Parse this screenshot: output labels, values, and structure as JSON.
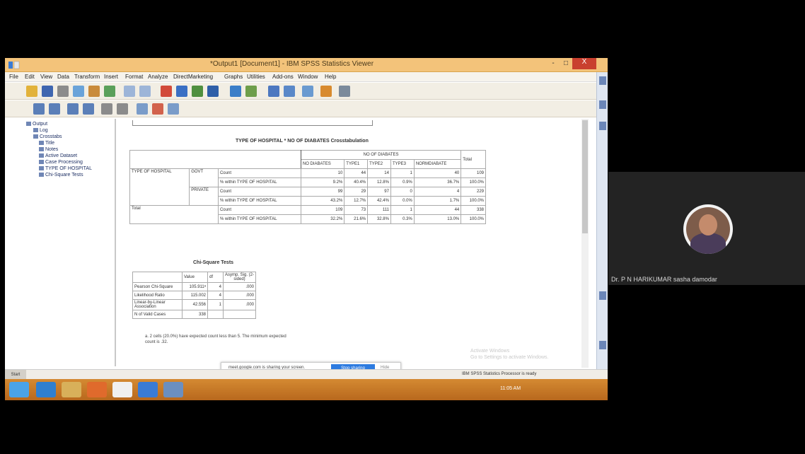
{
  "window": {
    "title": "*Output1 [Document1] - IBM SPSS Statistics Viewer",
    "min": "-",
    "max": "□",
    "close": "X"
  },
  "menu": [
    "File",
    "Edit",
    "View",
    "Data",
    "Transform",
    "Insert",
    "Format",
    "Analyze",
    "DirectMarketing",
    "Graphs",
    "Utilities",
    "Add-ons",
    "Window",
    "Help"
  ],
  "tree": [
    "Output",
    "Log",
    "Crosstabs",
    "Title",
    "Notes",
    "Active Dataset",
    "Case Processing",
    "TYPE OF HOSPITAL",
    "Chi-Square Tests"
  ],
  "crosstab": {
    "title": "TYPE OF HOSPITAL * NO OF DIABATES Crosstabulation",
    "group_header": "NO OF DIABATES",
    "col_headers": [
      "NO DIABATES",
      "TYPE1",
      "TYPE2",
      "TYPE3",
      "NORMDIABATE",
      "Total"
    ],
    "row_var": "TYPE OF HOSPITAL",
    "rows": [
      {
        "group": "GOVT",
        "stat": "Count",
        "values": [
          "10",
          "44",
          "14",
          "1",
          "40",
          "109"
        ]
      },
      {
        "group": "",
        "stat": "% within TYPE OF HOSPITAL",
        "values": [
          "9.2%",
          "40.4%",
          "12.8%",
          "0.9%",
          "36.7%",
          "100.0%"
        ]
      },
      {
        "group": "PRIVATE",
        "stat": "Count",
        "values": [
          "99",
          "29",
          "97",
          "0",
          "4",
          "229"
        ]
      },
      {
        "group": "",
        "stat": "% within TYPE OF HOSPITAL",
        "values": [
          "43.2%",
          "12.7%",
          "42.4%",
          "0.0%",
          "1.7%",
          "100.0%"
        ]
      },
      {
        "group": "Total",
        "stat": "Count",
        "values": [
          "109",
          "73",
          "111",
          "1",
          "44",
          "338"
        ]
      },
      {
        "group": "",
        "stat": "% within TYPE OF HOSPITAL",
        "values": [
          "32.2%",
          "21.6%",
          "32.8%",
          "0.3%",
          "13.0%",
          "100.0%"
        ]
      }
    ]
  },
  "chisq": {
    "title": "Chi-Square Tests",
    "headers": [
      "",
      "Value",
      "df",
      "Asymp. Sig. (2-sided)"
    ],
    "rows": [
      [
        "Pearson Chi-Square",
        "105.911ᵃ",
        "4",
        ".000"
      ],
      [
        "Likelihood Ratio",
        "115.002",
        "4",
        ".000"
      ],
      [
        "Linear-by-Linear Association",
        "42.556",
        "1",
        ".000"
      ],
      [
        "N of Valid Cases",
        "338",
        "",
        ""
      ]
    ],
    "footnote": "a. 2 cells (20.0%) have expected count less than 5. The minimum expected count is .32."
  },
  "notification": {
    "text": "meet.google.com is sharing your screen.",
    "stop_label": "Stop sharing",
    "hide_label": "Hide"
  },
  "watermark": {
    "line1": "Activate Windows",
    "line2": "Go to Settings to activate Windows."
  },
  "status": {
    "text": "IBM SPSS Statistics Processor is ready",
    "start_tag": "Start"
  },
  "tray": {
    "time": "11:05 AM"
  },
  "participant": {
    "name": "Dr. P N HARIKUMAR sasha damodar"
  }
}
